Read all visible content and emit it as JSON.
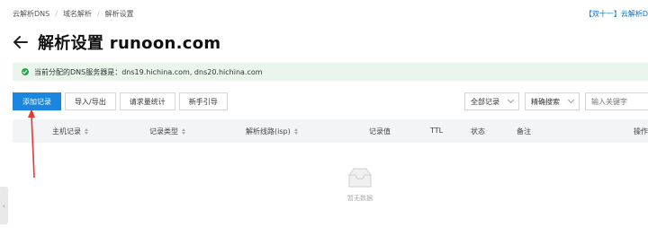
{
  "breadcrumb": [
    "云解析DNS",
    "域名解析",
    "解析设置"
  ],
  "promo_text": "【双十一】云解析D",
  "page_title": "解析设置 runoon.com",
  "notice": "当前分配的DNS服务器是：dns19.hichina.com, dns20.hichina.com",
  "toolbar": {
    "add_record": "添加记录",
    "import_export": "导入/导出",
    "request_stats": "请求量统计",
    "guide": "新手引导"
  },
  "filters": {
    "all_records": "全部记录",
    "exact_search": "精确搜索",
    "search_placeholder": "输入关键字"
  },
  "table": {
    "headers": [
      "主机记录",
      "记录类型",
      "解析线路(isp)",
      "记录值",
      "TTL",
      "状态",
      "备注",
      "操作"
    ]
  },
  "empty_text": "暂无数据",
  "colors": {
    "primary": "#1a86e0",
    "notice_bg": "#eaf6ec",
    "annotation_arrow": "#e53935"
  }
}
